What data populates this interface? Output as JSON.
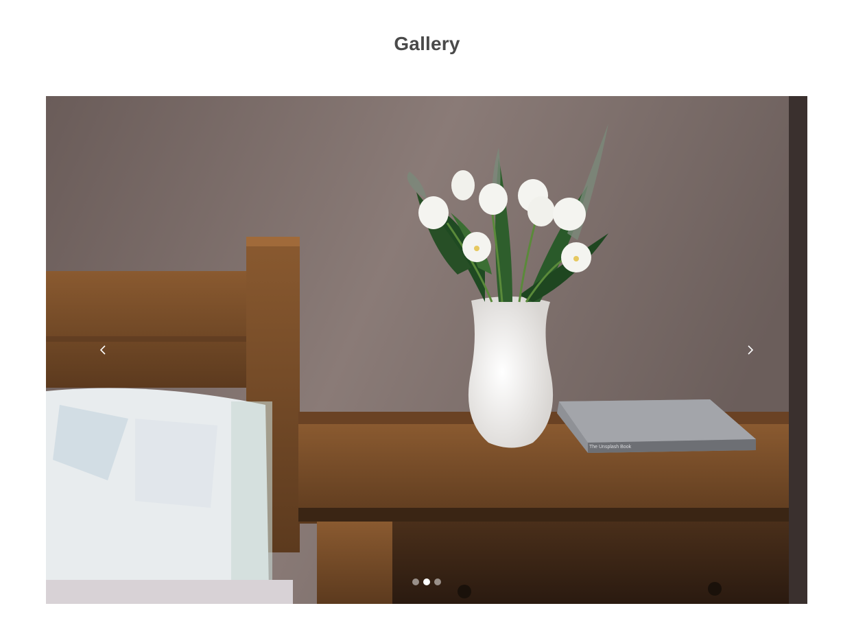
{
  "page": {
    "title": "Gallery"
  },
  "carousel": {
    "slide_count": 3,
    "active_slide": 2,
    "prev_icon": "chevron-left-icon",
    "next_icon": "chevron-right-icon",
    "book_title": "The Unsplash Book",
    "colors": {
      "indicator_active": "#ffffff",
      "indicator_inactive": "#b8b8b8",
      "title": "#4a4a4a"
    }
  }
}
